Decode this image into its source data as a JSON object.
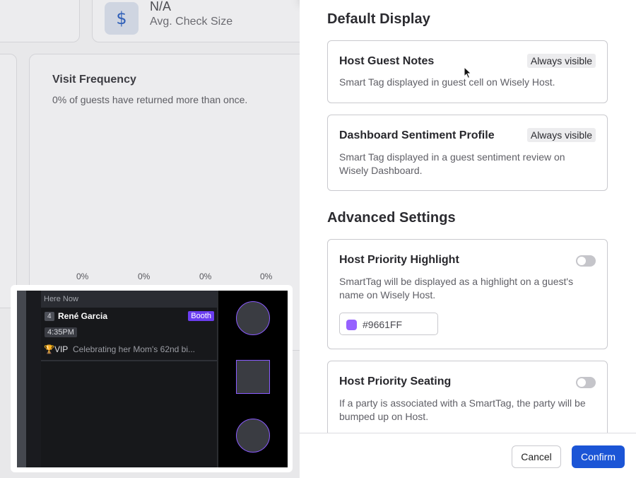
{
  "background": {
    "stat": {
      "icon": "dollar-icon",
      "icon_glyph": "$",
      "value": "N/A",
      "label": "Avg. Check Size"
    },
    "visit_frequency": {
      "title": "Visit Frequency",
      "subtitle": "0% of guests have returned more than once.",
      "percent_labels": [
        "0%",
        "0%",
        "0%",
        "0%"
      ]
    }
  },
  "preview": {
    "section_header": "Here Now",
    "guest": {
      "party_size": "4",
      "name": "René Garcia",
      "table_badge": "Booth",
      "time": "4:35PM",
      "vip_prefix": "🏆VIP",
      "note": "Celebrating her Mom's 62nd bi..."
    },
    "accent_color": "#6b3df0"
  },
  "panel": {
    "default_display": {
      "title": "Default Display",
      "items": [
        {
          "title": "Host Guest Notes",
          "badge": "Always visible",
          "description": "Smart Tag displayed in guest cell on Wisely Host."
        },
        {
          "title": "Dashboard Sentiment Profile",
          "badge": "Always visible",
          "description": "Smart Tag displayed in a guest sentiment review on Wisely Dashboard."
        }
      ]
    },
    "advanced_settings": {
      "title": "Advanced Settings",
      "items": [
        {
          "title": "Host Priority Highlight",
          "toggle_on": false,
          "description": "SmartTag will be displayed as a highlight on a guest's name on Wisely Host.",
          "color_value": "#9661FF"
        },
        {
          "title": "Host Priority Seating",
          "toggle_on": false,
          "description": "If a party is associated with a SmartTag, the party will be bumped up on Host."
        }
      ]
    },
    "footer": {
      "cancel_label": "Cancel",
      "confirm_label": "Confirm",
      "confirm_color": "#1b55d6"
    }
  }
}
